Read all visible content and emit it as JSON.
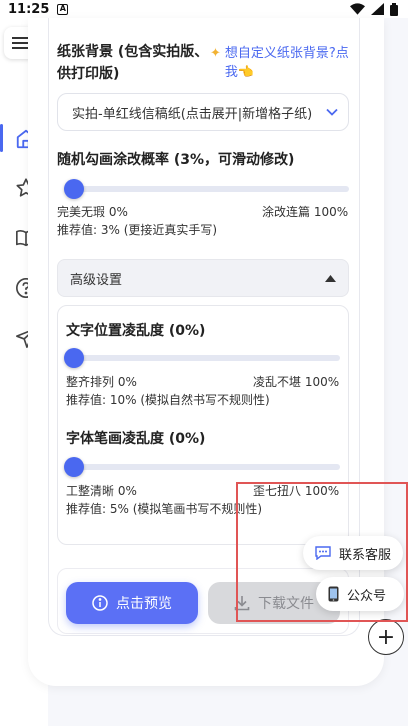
{
  "status_bar": {
    "time": "11:25",
    "sim_letter": "A"
  },
  "paper": {
    "label": "纸张背景 (包含实拍版、供打印版)",
    "custom_link": "想自定义纸张背景?点我",
    "link_emoji": "👈",
    "selected": "实拍-单红线信稿纸(点击展开|新增格子纸)"
  },
  "random_scribble": {
    "label": "随机勾画涂改概率 (3%，可滑动修改)",
    "min_label": "完美无瑕 0%",
    "max_label": "涂改连篇 100%",
    "recommend": "推荐值: 3% (更接近真实手写)",
    "value_percent": 3
  },
  "advanced": {
    "title": "高级设置",
    "text_position": {
      "label": "文字位置凌乱度 (0%)",
      "min_label": "整齐排列 0%",
      "max_label": "凌乱不堪 100%",
      "recommend": "推荐值: 10% (模拟自然书写不规则性)",
      "value_percent": 0
    },
    "stroke": {
      "label": "字体笔画凌乱度 (0%)",
      "min_label": "工整清晰 0%",
      "max_label": "歪七扭八 100%",
      "recommend": "推荐值: 5% (模拟笔画书写不规则性)",
      "value_percent": 0
    }
  },
  "buttons": {
    "preview": "点击预览",
    "download": "下载文件"
  },
  "floating": {
    "contact": "联系客服",
    "official": "公众号",
    "fab": "+"
  },
  "colors": {
    "accent": "#4a68f0",
    "annotation": "#e05555"
  }
}
